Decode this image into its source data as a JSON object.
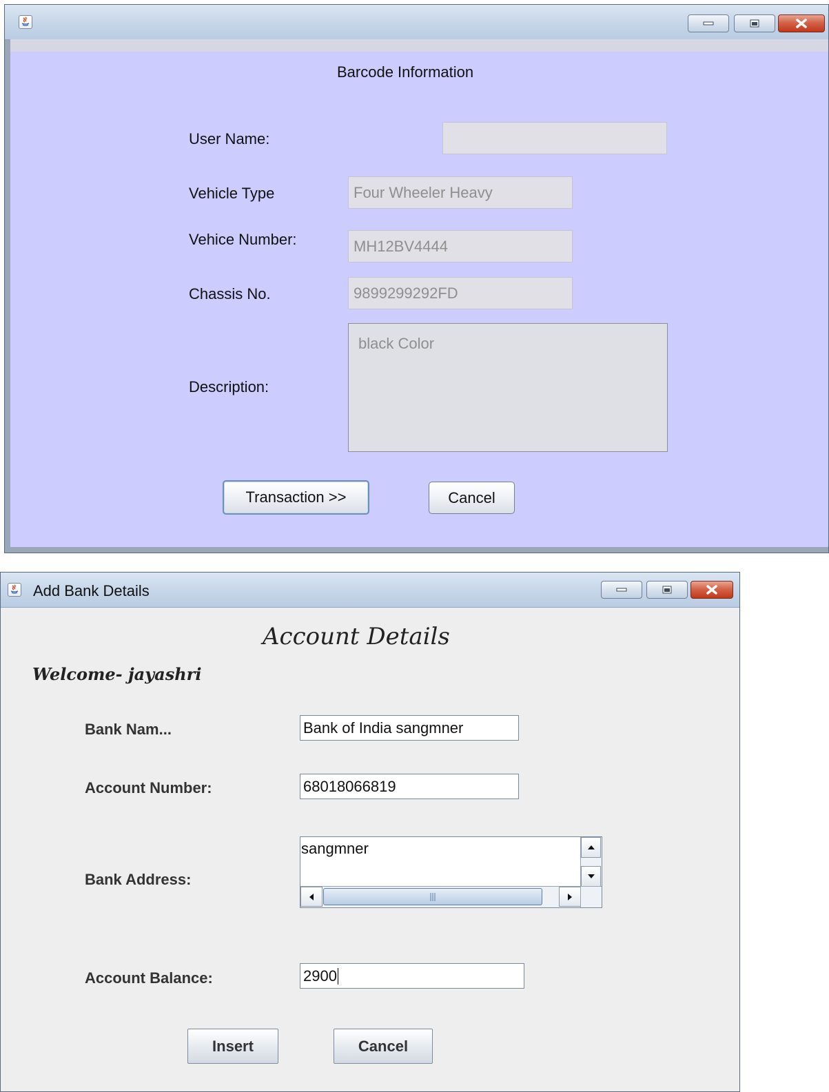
{
  "window1": {
    "heading": "Barcode Information",
    "fields": {
      "user_name": {
        "label": "User Name:",
        "value": ""
      },
      "vehicle_type": {
        "label": "Vehicle Type",
        "value": "Four Wheeler Heavy"
      },
      "vehicle_number": {
        "label": "Vehice Number:",
        "value": "MH12BV4444"
      },
      "chassis_no": {
        "label": "Chassis No.",
        "value": "9899299292FD"
      },
      "description": {
        "label": "Description:",
        "value": "black Color"
      }
    },
    "buttons": {
      "transaction": "Transaction >>",
      "cancel": "Cancel"
    }
  },
  "window2": {
    "title": "Add Bank Details",
    "heading": "Account Details",
    "welcome": "Welcome- jayashri",
    "fields": {
      "bank_name": {
        "label": "Bank Nam...",
        "value": "Bank of India sangmner"
      },
      "account_number": {
        "label": "Account Number:",
        "value": "68018066819"
      },
      "bank_address": {
        "label": "Bank Address:",
        "value": "sangmner"
      },
      "account_balance": {
        "label": "Account Balance:",
        "value": "2900"
      }
    },
    "buttons": {
      "insert": "Insert",
      "cancel": "Cancel"
    }
  },
  "icons": [
    "java-icon",
    "minimize-icon",
    "maximize-icon",
    "close-icon",
    "scroll-up-icon",
    "scroll-down-icon",
    "scroll-left-icon",
    "scroll-right-icon"
  ]
}
